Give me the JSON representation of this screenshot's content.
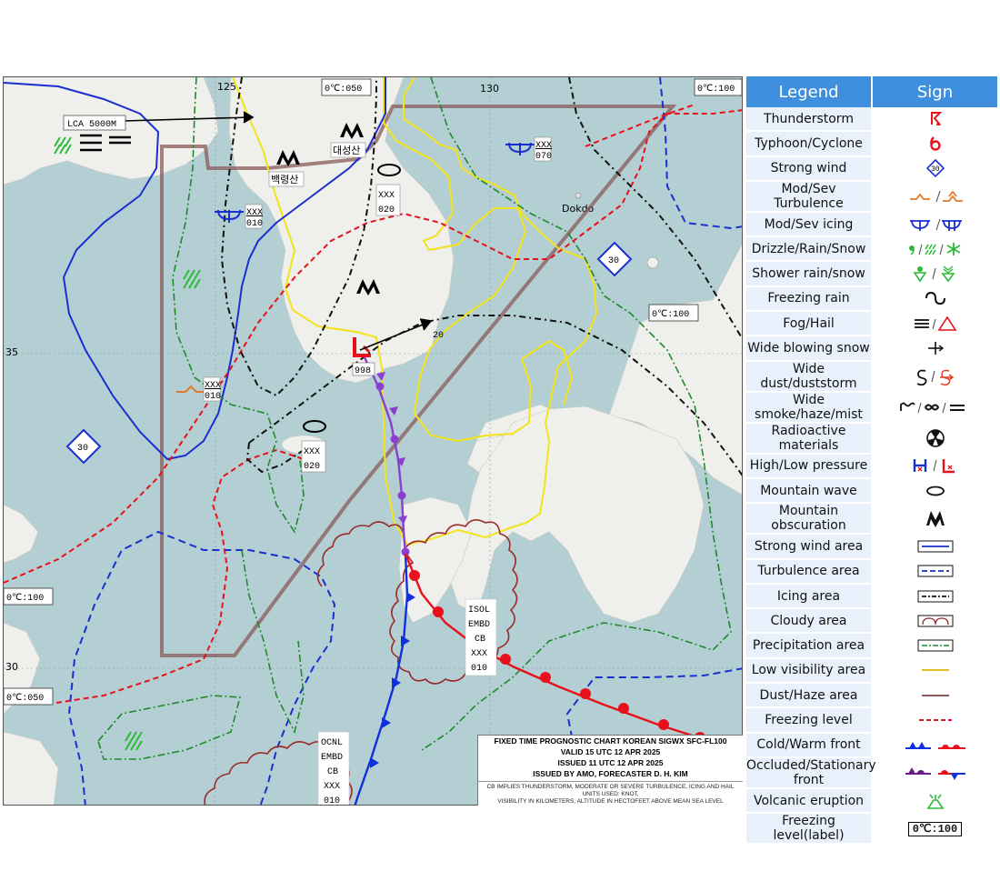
{
  "map": {
    "lon_labels": [
      "125",
      "130"
    ],
    "lat_labels": [
      "35",
      "30"
    ],
    "place_labels": {
      "dokdo": "Dokdo",
      "baengnyeong": "백령산",
      "daeseong": "대성산"
    },
    "freezing_level_labels": [
      "0℃:050",
      "0℃:100",
      "0℃:100",
      "0℃:100",
      "0℃:050"
    ],
    "lca_label": "LCA 5000M",
    "strong_wind_values": [
      "30",
      "30"
    ],
    "wind_arrow_value": "20",
    "low_pressure_value": "998",
    "icing_tags": [
      {
        "top": "XXX",
        "bottom": "070"
      },
      {
        "top": "XXX",
        "bottom": "010"
      }
    ],
    "turbulence_tag": {
      "top": "XXX",
      "bottom": "010"
    },
    "mountain_wave_tags": [
      {
        "top": "XXX",
        "bottom": "020"
      },
      {
        "top": "XXX",
        "bottom": "020"
      }
    ],
    "cb_isol": [
      "ISOL",
      "EMBD",
      "CB",
      "XXX",
      "010"
    ],
    "cb_ocnl": [
      "OCNL",
      "EMBD",
      "CB",
      "XXX",
      "010"
    ]
  },
  "title_box": {
    "line1": "FIXED TIME PROGNOSTIC CHART KOREAN SIGWX SFC-FL100",
    "line2": "VALID 15 UTC   12 APR 2025",
    "line3": "ISSUED 11 UTC   12 APR 2025",
    "line4": "ISSUED BY AMO, FORECASTER D. H. KIM",
    "note1": "CB IMPLIES THUNDERSTORM, MODERATE OR SEVERE TURBULENCE, ICING AND HAIL",
    "note2": "UNITS USED: KNOT,",
    "note3": "VISIBILITY IN KILOMETERS, ALTITUDE IN HECTOFEET ABOVE MEAN SEA LEVEL"
  },
  "legend": {
    "header_legend": "Legend",
    "header_sign": "Sign",
    "sign_value_strong_wind": "30",
    "sign_value_freezing_label": "0℃:100",
    "rows": [
      "Thunderstorm",
      "Typhoon/Cyclone",
      "Strong wind",
      "Mod/Sev Turbulence",
      "Mod/Sev icing",
      "Drizzle/Rain/Snow",
      "Shower rain/snow",
      "Freezing rain",
      "Fog/Hail",
      "Wide blowing snow",
      "Wide dust/duststorm",
      "Wide smoke/haze/mist",
      "Radioactive materials",
      "High/Low pressure",
      "Mountain wave",
      "Mountain obscuration",
      "Strong wind area",
      "Turbulence area",
      "Icing area",
      "Cloudy area",
      "Precipitation area",
      "Low visibility area",
      "Dust/Haze area",
      "Freezing level",
      "Cold/Warm front",
      "Occluded/Stationary front",
      "Volcanic eruption",
      "Freezing level(label)"
    ]
  },
  "colors": {
    "sea": "#b3cfd3",
    "land": "#efefec",
    "fir": "#8a5a5a",
    "cold_front": "#1030e0",
    "warm_front": "#e8101a",
    "occluded": "#8a3fd0",
    "low_visibility": "#f3e31a",
    "legend_header": "#3e8fde"
  }
}
